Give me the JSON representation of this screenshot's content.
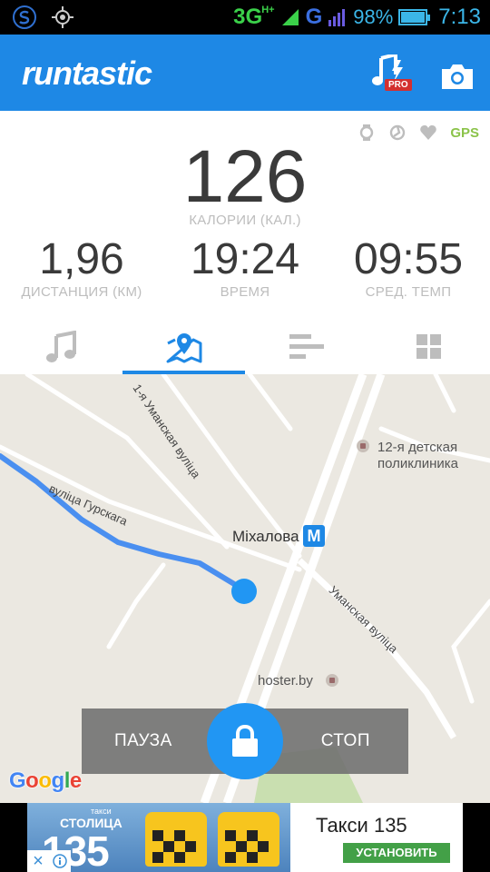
{
  "status_bar": {
    "network_primary": "3G",
    "network_primary_sup": "H+",
    "network_secondary": "G",
    "battery_percent": "98%",
    "battery_level": 0.98,
    "time": "7:13"
  },
  "app_bar": {
    "logo": "runtastic",
    "pro_badge": "PRO",
    "music_icon": "music-pro-icon",
    "camera_icon": "camera-icon"
  },
  "sensors": {
    "gps_label": "GPS",
    "icons": [
      "watch-icon",
      "cadence-icon",
      "heart-icon"
    ]
  },
  "stats": {
    "calories_value": "126",
    "calories_label": "КАЛОРИИ (КАЛ.)",
    "distance_value": "1,96",
    "distance_label": "ДИСТАНЦИЯ (КМ)",
    "time_value": "19:24",
    "time_label": "ВРЕМЯ",
    "pace_value": "09:55",
    "pace_label": "СРЕД. ТЕМП"
  },
  "tabs": [
    {
      "icon": "music-icon",
      "active": false
    },
    {
      "icon": "map-icon",
      "active": true
    },
    {
      "icon": "splits-icon",
      "active": false
    },
    {
      "icon": "dashboard-icon",
      "active": false
    }
  ],
  "map": {
    "street_1": "1-я Уманская вуліца",
    "street_2": "вуліца Гурскага",
    "street_3": "Уманская вуліца",
    "metro_name": "Міхалова",
    "metro_badge": "M",
    "poi_clinic_line1": "12-я детская",
    "poi_clinic_line2": "поликлиника",
    "poi_hoster": "hoster.by",
    "google_letters": [
      "G",
      "o",
      "o",
      "g",
      "l",
      "e"
    ]
  },
  "controls": {
    "pause_label": "ПАУЗА",
    "stop_label": "СТОП"
  },
  "ad": {
    "brand_small": "такси",
    "brand": "СТОЛИЦА",
    "number": "135",
    "title": "Такси 135",
    "cta": "УСТАНОВИТЬ",
    "close": "×"
  },
  "colors": {
    "accent": "#1e88e5",
    "gps": "#8bc34a",
    "route": "#4a8ff0",
    "location": "#2196f3",
    "cta": "#43a047"
  }
}
